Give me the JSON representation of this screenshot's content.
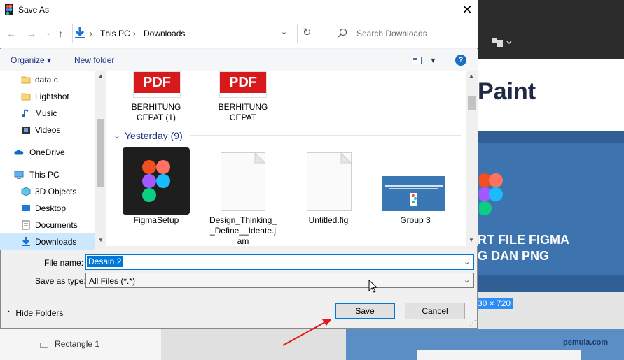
{
  "dialog": {
    "title": "Save As",
    "close": "✕",
    "colors": {
      "accent": "#0078d7",
      "link": "#1e3287"
    }
  },
  "address": {
    "crumbs": [
      "This PC",
      "Downloads"
    ],
    "separator": "›",
    "dropdown": "⌄",
    "refresh": "↻"
  },
  "search": {
    "placeholder": "Search Downloads"
  },
  "commands": {
    "organize": "Organize ▾",
    "new_folder": "New folder",
    "view": "▾",
    "help": "?"
  },
  "nav_pane": {
    "items": [
      {
        "label": "data c",
        "icon": "folder-icon"
      },
      {
        "label": "Lightshot",
        "icon": "folder-icon"
      },
      {
        "label": "Music",
        "icon": "music-icon"
      },
      {
        "label": "Videos",
        "icon": "videos-icon"
      },
      {
        "label": "OneDrive",
        "icon": "onedrive-icon"
      },
      {
        "label": "This PC",
        "icon": "this-pc-icon"
      },
      {
        "label": "3D Objects",
        "icon": "3d-objects-icon"
      },
      {
        "label": "Desktop",
        "icon": "desktop-icon"
      },
      {
        "label": "Documents",
        "icon": "documents-icon"
      },
      {
        "label": "Downloads",
        "icon": "downloads-icon",
        "selected": true
      }
    ]
  },
  "content": {
    "top_files": [
      {
        "name": "BERHITUNG CEPAT (1)",
        "icon": "pdf-icon",
        "badge": "PDF"
      },
      {
        "name": "BERHITUNG CEPAT",
        "icon": "pdf-icon",
        "badge": "PDF"
      }
    ],
    "group": {
      "label": "Yesterday (9)",
      "chevron": "⌄"
    },
    "files": [
      {
        "name": "FigmaSetup",
        "icon": "figma-setup-icon"
      },
      {
        "name": "Design_Thinking_ _Define__Ideate.j am",
        "icon": "document-icon"
      },
      {
        "name": "Untitled.fig",
        "icon": "document-icon"
      },
      {
        "name": "Group 3",
        "icon": "image-thumbnail-icon"
      }
    ]
  },
  "form": {
    "file_name_label": "File name:",
    "file_name_value": "Desain 2",
    "save_type_label": "Save as type:",
    "save_type_value": "All Files (*.*)",
    "dropdown_chev": "⌄"
  },
  "footer": {
    "hide_folders": "Hide Folders",
    "hide_chevron": "⌃",
    "save": "Save",
    "cancel": "Cancel"
  },
  "background_app": {
    "heading": "Paint",
    "banner_line1": "RT FILE FIGMA",
    "banner_line2": "G DAN PNG",
    "dimensions": "30 × 720",
    "layer": "Rectangle 1",
    "watermark": "pemula.com"
  }
}
